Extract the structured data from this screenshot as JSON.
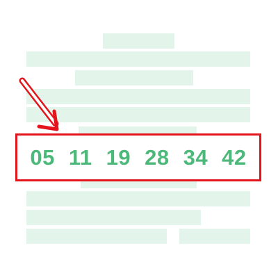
{
  "numbers": [
    "05",
    "11",
    "19",
    "28",
    "34",
    "42"
  ],
  "colors": {
    "placeholder_bar": "#e3f4ea",
    "number_text": "#4cb879",
    "highlight_border": "#e3141b",
    "arrow": "#e3141b"
  },
  "icons": {
    "pointer": "arrow-icon"
  }
}
